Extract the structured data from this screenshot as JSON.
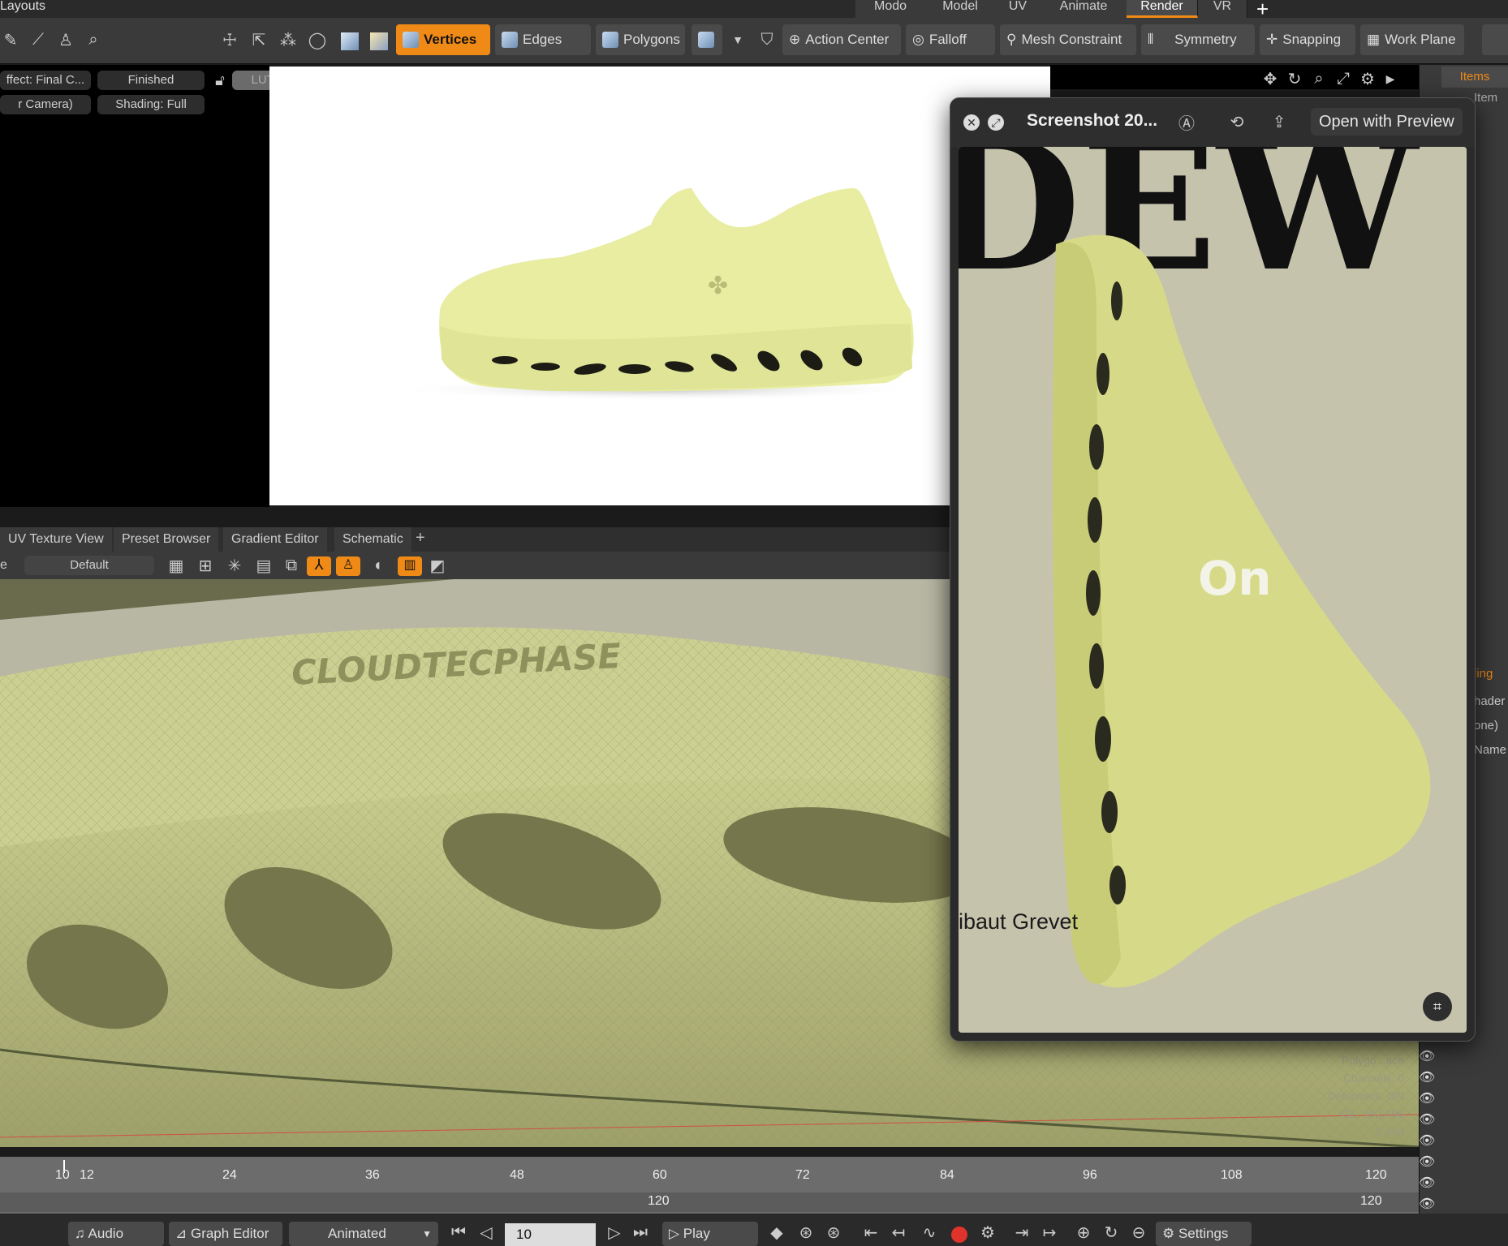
{
  "layouts_title": "Layouts",
  "layout_tabs": [
    "Modo",
    "Model",
    "UV",
    "Animate",
    "Render",
    "VR"
  ],
  "active_layout": "Render",
  "add_tab_symbol": "+",
  "toolbar": {
    "vertices": "Vertices",
    "edges": "Edges",
    "polygons": "Polygons",
    "action_center": "Action Center",
    "falloff": "Falloff",
    "mesh_constraint": "Mesh Constraint",
    "symmetry": "Symmetry",
    "snapping": "Snapping",
    "work_plane": "Work Plane"
  },
  "viewport": {
    "effect": "ffect: Final C...",
    "status": "Finished",
    "lut": "LUT: sRGB",
    "camera": "r Camera)",
    "shading": "Shading: Full"
  },
  "right_panel": {
    "items_tab": "Items",
    "add_item": "Item",
    "shading_tab": "ling",
    "shader": "hader",
    "none": "one)",
    "name": "Name"
  },
  "bottom_tabs": [
    "UV Texture View",
    "Preset Browser",
    "Gradient Editor",
    "Schematic"
  ],
  "bottom_add": "+",
  "vp2": {
    "left_label": "e",
    "default_label": "Default"
  },
  "mesh_text": "CLOUDTECPHASE",
  "overlay_info": [
    "Polygo...ace",
    "Channels: 0",
    "Deformers: ON",
    "GL: 152,496",
    "5 mm"
  ],
  "preview": {
    "title": "Screenshot 20...",
    "open_with": "Open with Preview",
    "headline": "DEW",
    "credit": "ibaut Grevet",
    "logo": "On"
  },
  "timeline": {
    "ticks": [
      "10",
      "12",
      "24",
      "36",
      "48",
      "60",
      "72",
      "84",
      "96",
      "108",
      "120"
    ],
    "current_frame": "10",
    "end_frame": "120",
    "end_frame_right": "120"
  },
  "transport": {
    "audio": "Audio",
    "graph_editor": "Graph Editor",
    "animated": "Animated",
    "frame_value": "10",
    "play": "Play",
    "settings": "Settings"
  },
  "colors": {
    "accent": "#f08a17",
    "shoe": "#e6eca0",
    "mesh": "#c9cf8e"
  }
}
